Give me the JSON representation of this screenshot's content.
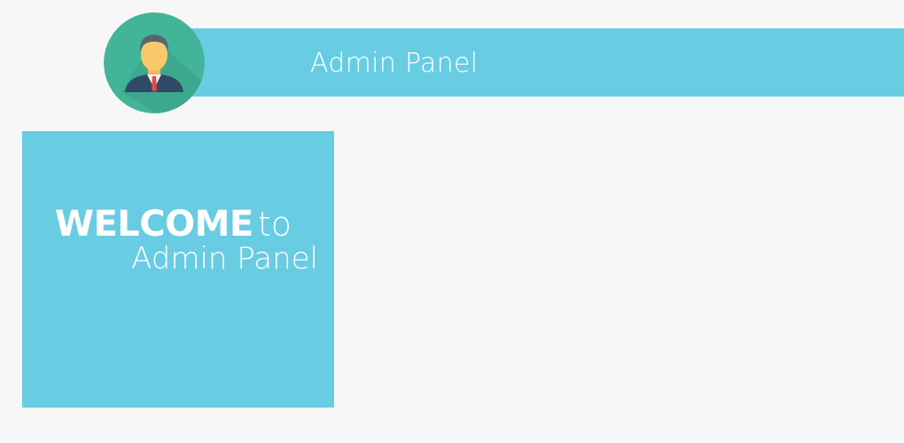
{
  "header": {
    "title": "Admin Panel",
    "avatar_icon": "user-avatar-icon"
  },
  "welcome": {
    "bold": "WELCOME",
    "connector": "to",
    "subtitle": "Admin Panel"
  },
  "colors": {
    "accent": "#68cce3",
    "background": "#f7f7f7",
    "avatar_circle": "#42b497",
    "text": "#ffffff"
  }
}
